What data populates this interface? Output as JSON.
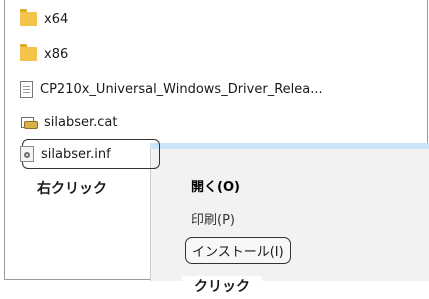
{
  "files": [
    {
      "name": "x64",
      "icon": "folder-icon"
    },
    {
      "name": "x86",
      "icon": "folder-icon"
    },
    {
      "name": "CP210x_Universal_Windows_Driver_Relea...",
      "icon": "document-icon"
    },
    {
      "name": "silabser.cat",
      "icon": "security-catalog-icon"
    },
    {
      "name": "silabser.inf",
      "icon": "setup-information-icon"
    }
  ],
  "context_menu": {
    "open_label": "開く(O)",
    "print_label": "印刷(P)",
    "install_label": "インストール(I)"
  },
  "annotations": {
    "right_click": "右クリック",
    "click": "クリック"
  },
  "colors": {
    "folder": "#f3c44a",
    "menu_background": "#f2f2f2",
    "menu_highlight": "#cce4f7"
  }
}
